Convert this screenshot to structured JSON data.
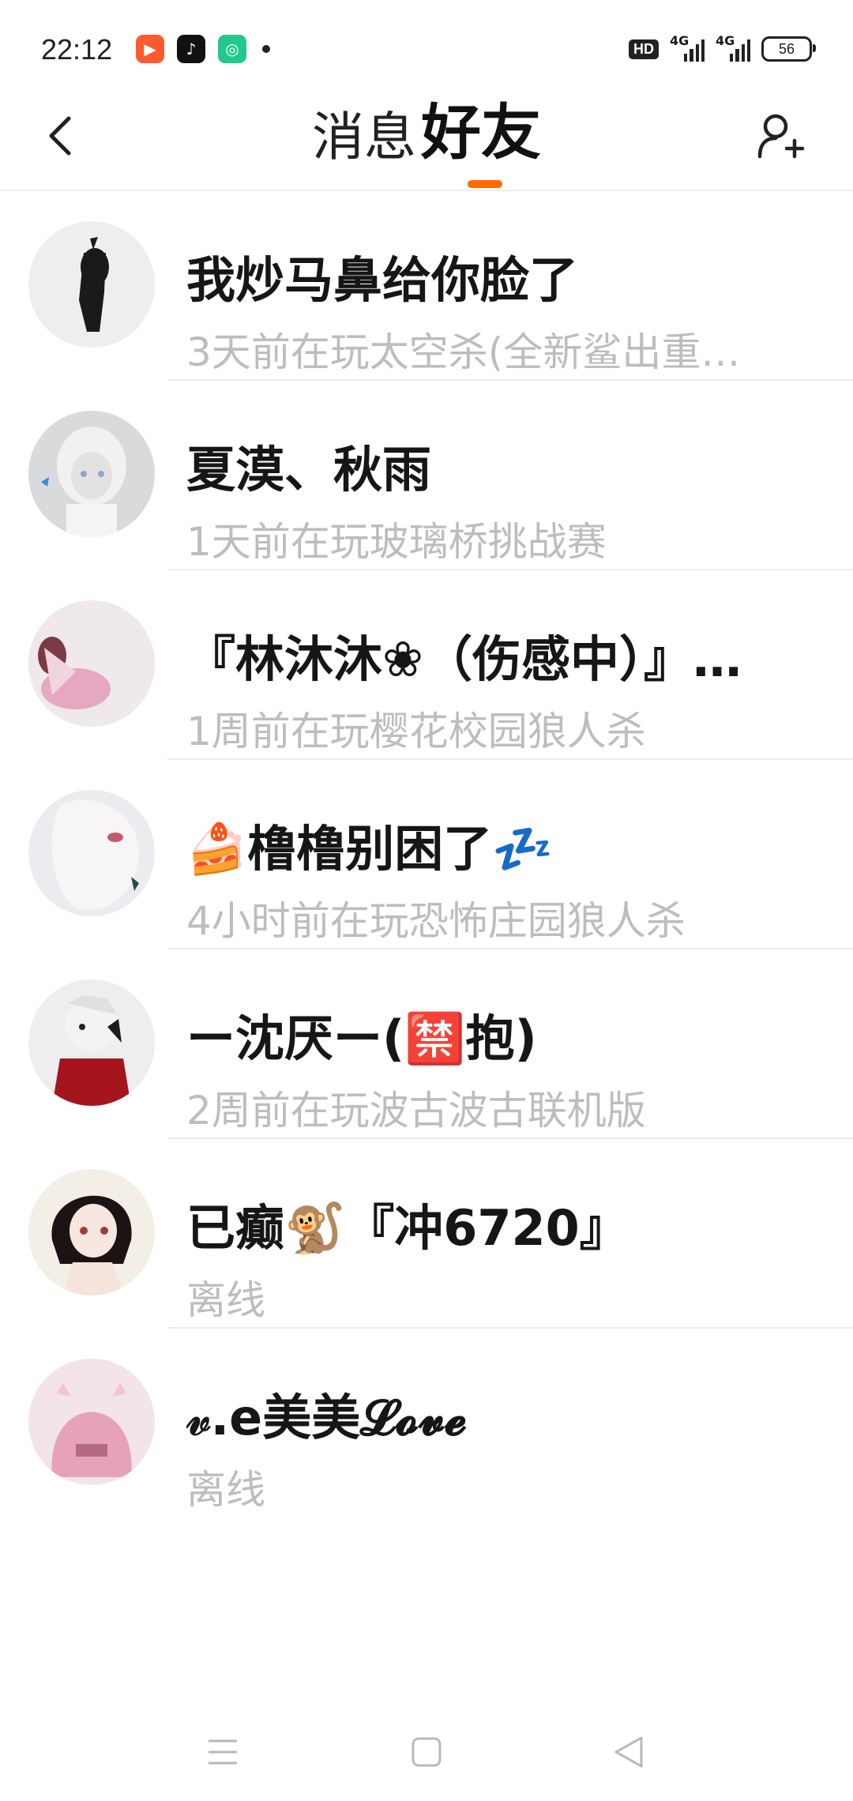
{
  "status_bar": {
    "time": "22:12",
    "app_icons": [
      {
        "name": "kuaishou-icon",
        "color": "#ff5a2e"
      },
      {
        "name": "tiktok-icon",
        "color": "#111111"
      },
      {
        "name": "game-app-icon",
        "color": "#21c98a"
      }
    ],
    "hd_label": "HD",
    "signal_label_1": "4G",
    "signal_label_2": "4G",
    "battery": "56"
  },
  "header": {
    "tab_messages": "消息",
    "tab_friends": "好友",
    "active_tab": "好友",
    "accent_color": "#ff6a00"
  },
  "friends": [
    {
      "name": "我炒马鼻给你脸了",
      "status": "3天前在玩太空杀(全新鲨出重…"
    },
    {
      "name": "夏漠、秋雨",
      "status": "1天前在玩玻璃桥挑战赛"
    },
    {
      "name": "『林沐沐❀（伤感中）』…",
      "status": "1周前在玩樱花校园狼人杀"
    },
    {
      "name": "🍰橹橹别困了💤",
      "status": "4小时前在玩恐怖庄园狼人杀"
    },
    {
      "name": "ー沈厌ー(🈲抱)",
      "status": "2周前在玩波古波古联机版"
    },
    {
      "name": "已癫🐒『冲6720』",
      "status": "离线"
    },
    {
      "name": "𝓋.e美美𝓛𝓸𝓿𝓮",
      "status": "离线"
    }
  ],
  "nav": {
    "menu": "menu-icon",
    "home": "home-icon",
    "back": "back-triangle-icon"
  }
}
